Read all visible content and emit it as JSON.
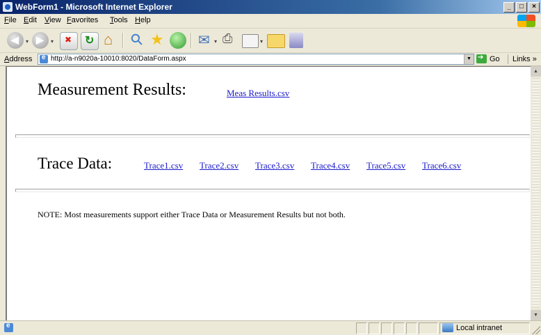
{
  "window": {
    "title": "WebForm1 - Microsoft Internet Explorer",
    "buttons": [
      "_",
      "□",
      "×"
    ]
  },
  "menu": [
    "File",
    "Edit",
    "View",
    "Favorites",
    "Tools",
    "Help"
  ],
  "address": {
    "label": "Address",
    "url": "http://a-n9020a-10010:8020/DataForm.aspx",
    "go_label": "Go",
    "links_label": "Links »"
  },
  "page": {
    "measurement_heading": "Measurement Results:",
    "measurement_link": "Meas Results.csv",
    "trace_heading": "Trace Data:",
    "trace_links": [
      "Trace1.csv",
      "Trace2.csv",
      "Trace3.csv",
      "Trace4.csv",
      "Trace5.csv",
      "Trace6.csv"
    ],
    "note": "NOTE: Most measurements support either Trace Data or Measurement Results but not both."
  },
  "status": {
    "zone": "Local intranet"
  }
}
